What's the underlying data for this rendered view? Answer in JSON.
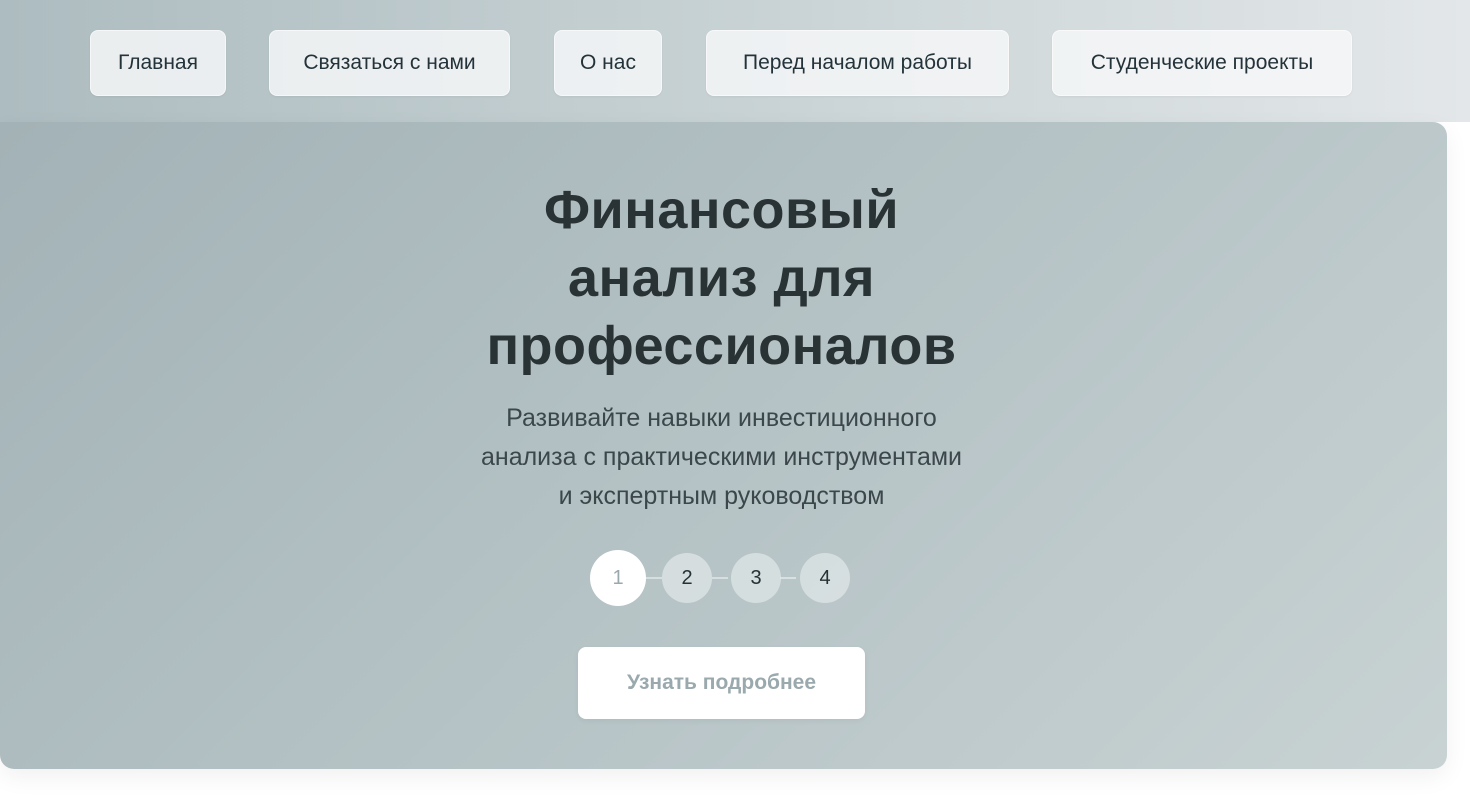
{
  "nav": {
    "items": [
      {
        "label": "Главная"
      },
      {
        "label": "Связаться с нами"
      },
      {
        "label": "О нас"
      },
      {
        "label": "Перед началом работы"
      },
      {
        "label": "Студенческие проекты"
      }
    ]
  },
  "hero": {
    "title_lines": [
      "Финансовый",
      "анализ для",
      "профессионалов"
    ],
    "subtitle_lines": [
      "Развивайте навыки инвестиционного",
      "анализа с практическими инструментами",
      "и экспертным руководством"
    ],
    "steps": [
      "1",
      "2",
      "3",
      "4"
    ],
    "active_step": "1",
    "cta_label": "Узнать подробнее"
  },
  "colors": {
    "title": "#293335",
    "subtitle": "#3b474b",
    "cta_text": "#9aa9ad"
  }
}
